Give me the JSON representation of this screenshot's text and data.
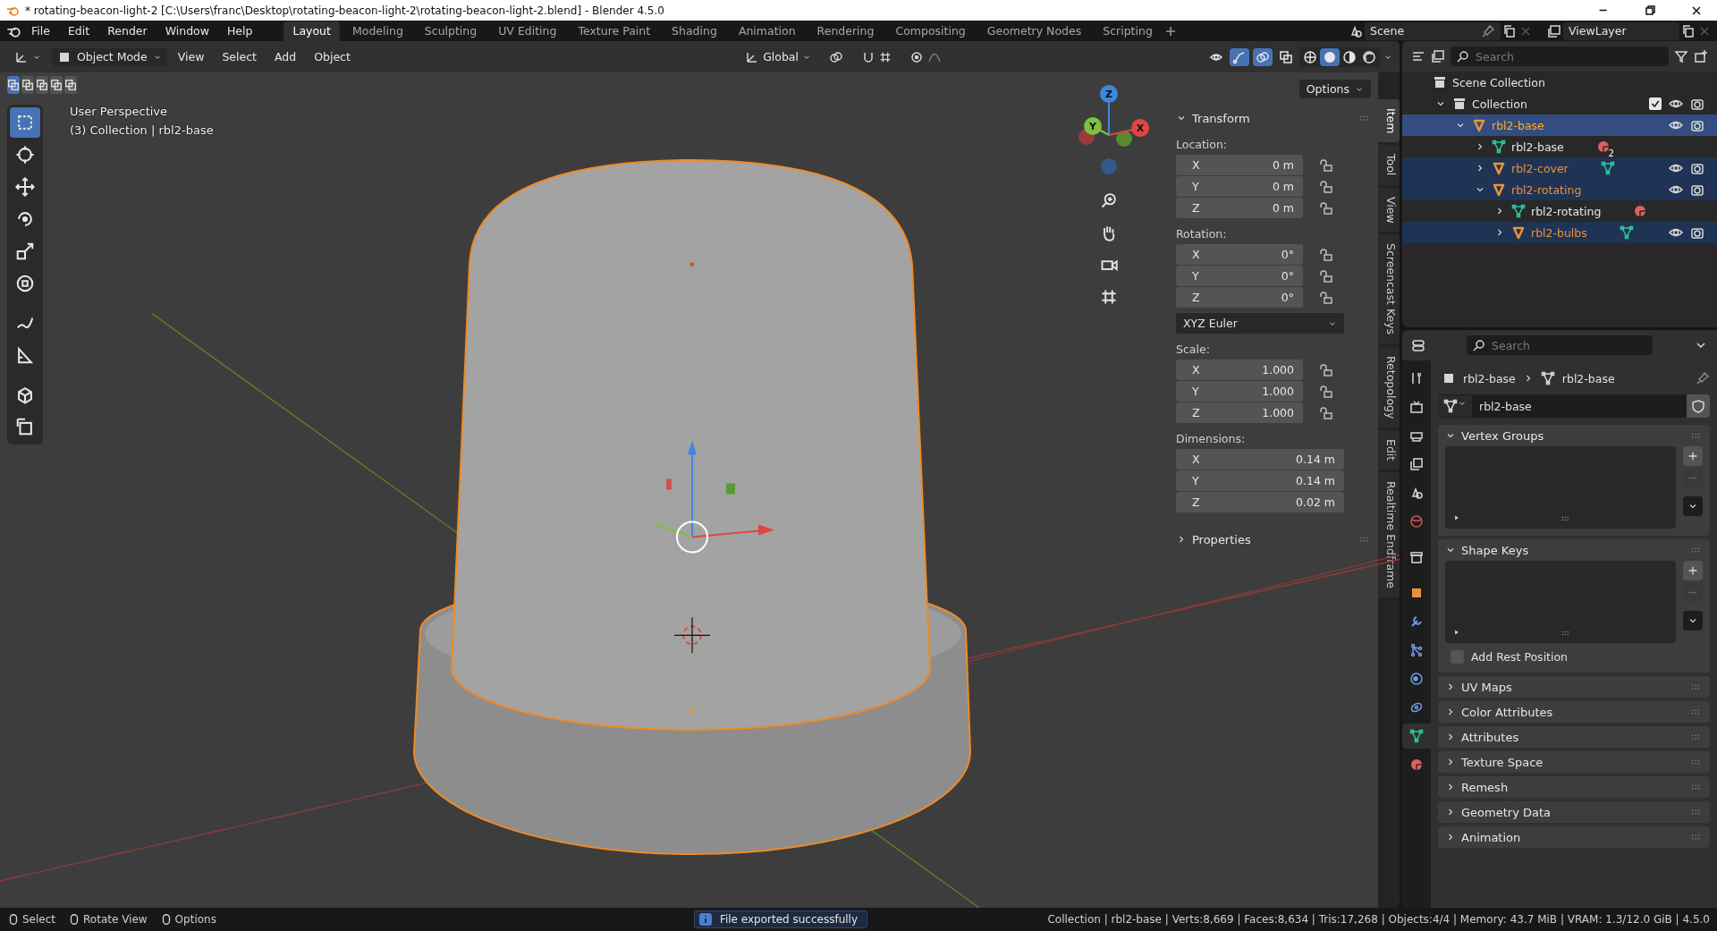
{
  "window": {
    "title": "* rotating-beacon-light-2 [C:\\Users\\franc\\Desktop\\rotating-beacon-light-2\\rotating-beacon-light-2.blend] - Blender 4.5.0"
  },
  "menu": [
    "File",
    "Edit",
    "Render",
    "Window",
    "Help"
  ],
  "workspaces": [
    {
      "label": "Layout",
      "selected": true
    },
    {
      "label": "Modeling",
      "selected": false
    },
    {
      "label": "Sculpting",
      "selected": false
    },
    {
      "label": "UV Editing",
      "selected": false
    },
    {
      "label": "Texture Paint",
      "selected": false
    },
    {
      "label": "Shading",
      "selected": false
    },
    {
      "label": "Animation",
      "selected": false
    },
    {
      "label": "Rendering",
      "selected": false
    },
    {
      "label": "Compositing",
      "selected": false
    },
    {
      "label": "Geometry Nodes",
      "selected": false
    },
    {
      "label": "Scripting",
      "selected": false
    }
  ],
  "scene": "Scene",
  "view_layer": "ViewLayer",
  "viewport_header": {
    "mode": "Object Mode",
    "menus": [
      "View",
      "Select",
      "Add",
      "Object"
    ],
    "orientation": "Global",
    "toggles": [
      {
        "kind": "visibility",
        "on": false
      },
      {
        "kind": "gizmo",
        "on": true
      },
      {
        "kind": "overlay",
        "on": true
      },
      {
        "kind": "xray",
        "on": false
      }
    ],
    "shading": [
      {
        "kind": "wire",
        "selected": false
      },
      {
        "kind": "solid",
        "selected": true
      },
      {
        "kind": "material",
        "selected": false
      },
      {
        "kind": "rendered",
        "selected": false
      }
    ]
  },
  "select_modes": [
    {
      "selected": true
    },
    {
      "selected": false
    },
    {
      "selected": false
    },
    {
      "selected": false
    },
    {
      "selected": false
    }
  ],
  "options_button": "Options",
  "tools": [
    {
      "kind": "select",
      "selected": true
    },
    {
      "kind": "cursor",
      "selected": false
    },
    {
      "kind": "move",
      "selected": false
    },
    {
      "kind": "rotate",
      "selected": false
    },
    {
      "kind": "scale",
      "selected": false
    },
    {
      "kind": "transform",
      "selected": false
    },
    {
      "kind": "annotate",
      "selected": false
    },
    {
      "kind": "measure",
      "selected": false
    },
    {
      "kind": "add_cube",
      "selected": false
    },
    {
      "kind": "add_cube2",
      "selected": false
    }
  ],
  "overlay_text": [
    "User Perspective",
    "(3) Collection | rbl2-base"
  ],
  "gizmo_axes": [
    "Z",
    "Y",
    "X"
  ],
  "n_panel": {
    "transform": {
      "title": "Transform",
      "expanded": true,
      "groups": [
        {
          "label": "Location:",
          "kind": "lockable",
          "rows": [
            {
              "axis": "X",
              "value": "0 m"
            },
            {
              "axis": "Y",
              "value": "0 m"
            },
            {
              "axis": "Z",
              "value": "0 m"
            }
          ]
        },
        {
          "label": "Rotation:",
          "kind": "lockable",
          "rows": [
            {
              "axis": "X",
              "value": "0°"
            },
            {
              "axis": "Y",
              "value": "0°"
            },
            {
              "axis": "Z",
              "value": "0°"
            }
          ],
          "mode": "XYZ Euler"
        },
        {
          "label": "Scale:",
          "kind": "lockable",
          "rows": [
            {
              "axis": "X",
              "value": "1.000"
            },
            {
              "axis": "Y",
              "value": "1.000"
            },
            {
              "axis": "Z",
              "value": "1.000"
            }
          ]
        },
        {
          "label": "Dimensions:",
          "kind": "plain",
          "rows": [
            {
              "axis": "X",
              "value": "0.14 m"
            },
            {
              "axis": "Y",
              "value": "0.14 m"
            },
            {
              "axis": "Z",
              "value": "0.02 m"
            }
          ]
        }
      ]
    },
    "properties": {
      "title": "Properties",
      "expanded": false
    }
  },
  "side_tabs": [
    {
      "label": "Item",
      "selected": true
    },
    {
      "label": "Tool",
      "selected": false
    },
    {
      "label": "View",
      "selected": false
    },
    {
      "label": "Screencast Keys",
      "selected": false
    },
    {
      "label": "Retopology",
      "selected": false
    },
    {
      "label": "Edit",
      "selected": false
    },
    {
      "label": "Realtime Endframe",
      "selected": false
    }
  ],
  "outliner": {
    "search": {
      "placeholder": "Search"
    },
    "tree": [
      {
        "label": "Scene Collection",
        "kind": "scene_collection",
        "children": [
          {
            "label": "Collection",
            "kind": "collection",
            "expanded": true,
            "checked": true,
            "selected": false,
            "children": [
              {
                "label": "rbl2-base",
                "kind": "object",
                "expanded": true,
                "selected": true,
                "active": true,
                "children": [
                  {
                    "label": "rbl2-base",
                    "kind": "mesh",
                    "expanded": false,
                    "selected": false,
                    "extra": {
                      "kind": "material",
                      "count": "2"
                    }
                  },
                  {
                    "label": "rbl2-cover",
                    "kind": "object",
                    "expanded": false,
                    "selected": true,
                    "active": false,
                    "extra": {
                      "kind": "mesh"
                    }
                  },
                  {
                    "label": "rbl2-rotating",
                    "kind": "object",
                    "expanded": true,
                    "selected": true,
                    "active": false,
                    "children": [
                      {
                        "label": "rbl2-rotating",
                        "kind": "mesh",
                        "expanded": false,
                        "selected": false,
                        "extra": {
                          "kind": "material"
                        }
                      },
                      {
                        "label": "rbl2-bulbs",
                        "kind": "object",
                        "expanded": false,
                        "selected": true,
                        "active": false,
                        "extra": {
                          "kind": "mesh"
                        }
                      }
                    ]
                  }
                ]
              }
            ]
          }
        ]
      }
    ]
  },
  "properties_editor": {
    "search": {
      "placeholder": "Search"
    },
    "tabs": [
      {
        "kind": "tool",
        "selected": false
      },
      {
        "kind": "render",
        "selected": false
      },
      {
        "kind": "output",
        "selected": false
      },
      {
        "kind": "view_layer",
        "selected": false
      },
      {
        "kind": "scene",
        "selected": false
      },
      {
        "kind": "world",
        "selected": false
      },
      {
        "kind": "collection",
        "selected": false
      },
      {
        "kind": "object",
        "selected": false
      },
      {
        "kind": "modifiers",
        "selected": false
      },
      {
        "kind": "particles",
        "selected": false
      },
      {
        "kind": "physics",
        "selected": false
      },
      {
        "kind": "constraints",
        "selected": false
      },
      {
        "kind": "data",
        "selected": true
      },
      {
        "kind": "material",
        "selected": false
      }
    ],
    "breadcrumb": [
      "rbl2-base",
      "rbl2-base"
    ],
    "mesh_name": "rbl2-base",
    "panels": [
      {
        "title": "Vertex Groups",
        "expanded": true,
        "kind": "list"
      },
      {
        "title": "Shape Keys",
        "expanded": true,
        "kind": "list",
        "checkbox": {
          "label": "Add Rest Position",
          "checked": false
        }
      },
      {
        "title": "UV Maps",
        "expanded": false
      },
      {
        "title": "Color Attributes",
        "expanded": false
      },
      {
        "title": "Attributes",
        "expanded": false
      },
      {
        "title": "Texture Space",
        "expanded": false
      },
      {
        "title": "Remesh",
        "expanded": false
      },
      {
        "title": "Geometry Data",
        "expanded": false
      },
      {
        "title": "Animation",
        "expanded": false
      }
    ]
  },
  "status_bar": {
    "hints": [
      "Select",
      "Rotate View",
      "Options"
    ],
    "message": "File exported successfully",
    "stats": "Collection | rbl2-base | Verts:8,669 | Faces:8,634 | Tris:17,268 | Objects:4/4 | Memory: 43.7 MiB | VRAM: 1.3/12.0 GiB | 4.5.0"
  }
}
